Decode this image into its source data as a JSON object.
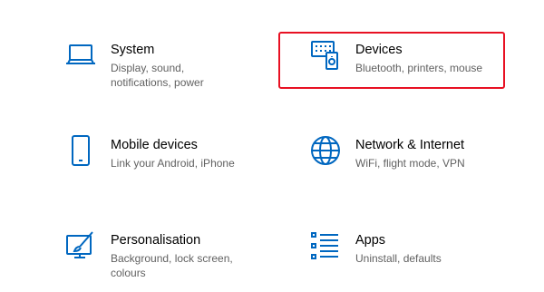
{
  "colors": {
    "accent": "#0067c0",
    "highlight": "#e81123",
    "title": "#000000",
    "desc": "#616161"
  },
  "tiles": [
    {
      "icon": "laptop-icon",
      "title": "System",
      "desc": "Display, sound, notifications, power"
    },
    {
      "icon": "devices-icon",
      "title": "Devices",
      "desc": "Bluetooth, printers, mouse"
    },
    {
      "icon": "phone-icon",
      "title": "Mobile devices",
      "desc": "Link your Android, iPhone"
    },
    {
      "icon": "globe-icon",
      "title": "Network & Internet",
      "desc": "WiFi, flight mode, VPN"
    },
    {
      "icon": "personalisation-icon",
      "title": "Personalisation",
      "desc": "Background, lock screen, colours"
    },
    {
      "icon": "apps-icon",
      "title": "Apps",
      "desc": "Uninstall, defaults"
    }
  ]
}
